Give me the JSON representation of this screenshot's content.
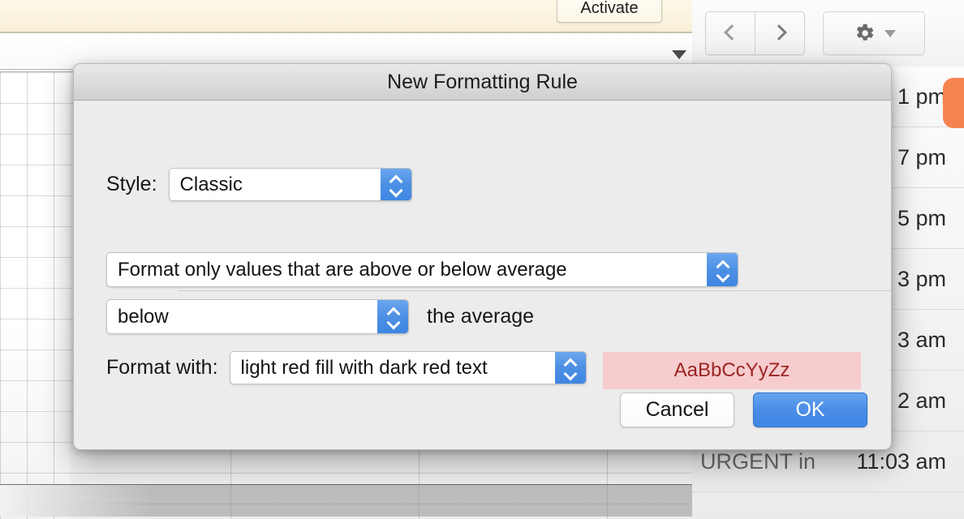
{
  "background": {
    "banner": {
      "activate_label": "Activate"
    },
    "toolbar": {
      "back_icon": "chevron-left-icon",
      "forward_icon": "chevron-right-icon",
      "gear_icon": "gear-icon",
      "caret_icon": "caret-down-icon"
    },
    "panel_rows": [
      {
        "label": "",
        "time": "1 pm",
        "bold": true,
        "pill": true
      },
      {
        "label": "",
        "time": "7 pm",
        "bold": false,
        "pill": false
      },
      {
        "label": "",
        "time": "5 pm",
        "bold": false,
        "pill": false
      },
      {
        "label": "",
        "time": "3 pm",
        "bold": false,
        "pill": false
      },
      {
        "label": "",
        "time": "3 am",
        "bold": false,
        "pill": false
      },
      {
        "label": "",
        "time": "2 am",
        "bold": false,
        "pill": false
      },
      {
        "label": "URGENT in",
        "time": "11:03 am",
        "bold": false,
        "pill": false
      }
    ]
  },
  "dialog": {
    "title": "New Formatting Rule",
    "style_label": "Style:",
    "style_value": "Classic",
    "condition_value": "Format only values that are above or below average",
    "direction_value": "below",
    "average_label": "the average",
    "format_with_label": "Format with:",
    "format_with_value": "light red fill with dark red text",
    "preview_text": "AaBbCcYyZz",
    "cancel_label": "Cancel",
    "ok_label": "OK",
    "colors": {
      "preview_fill": "#f7ccce",
      "preview_text": "#9b2423",
      "accent": "#4a8ee6",
      "ok_button": "#4a8ee6"
    }
  }
}
